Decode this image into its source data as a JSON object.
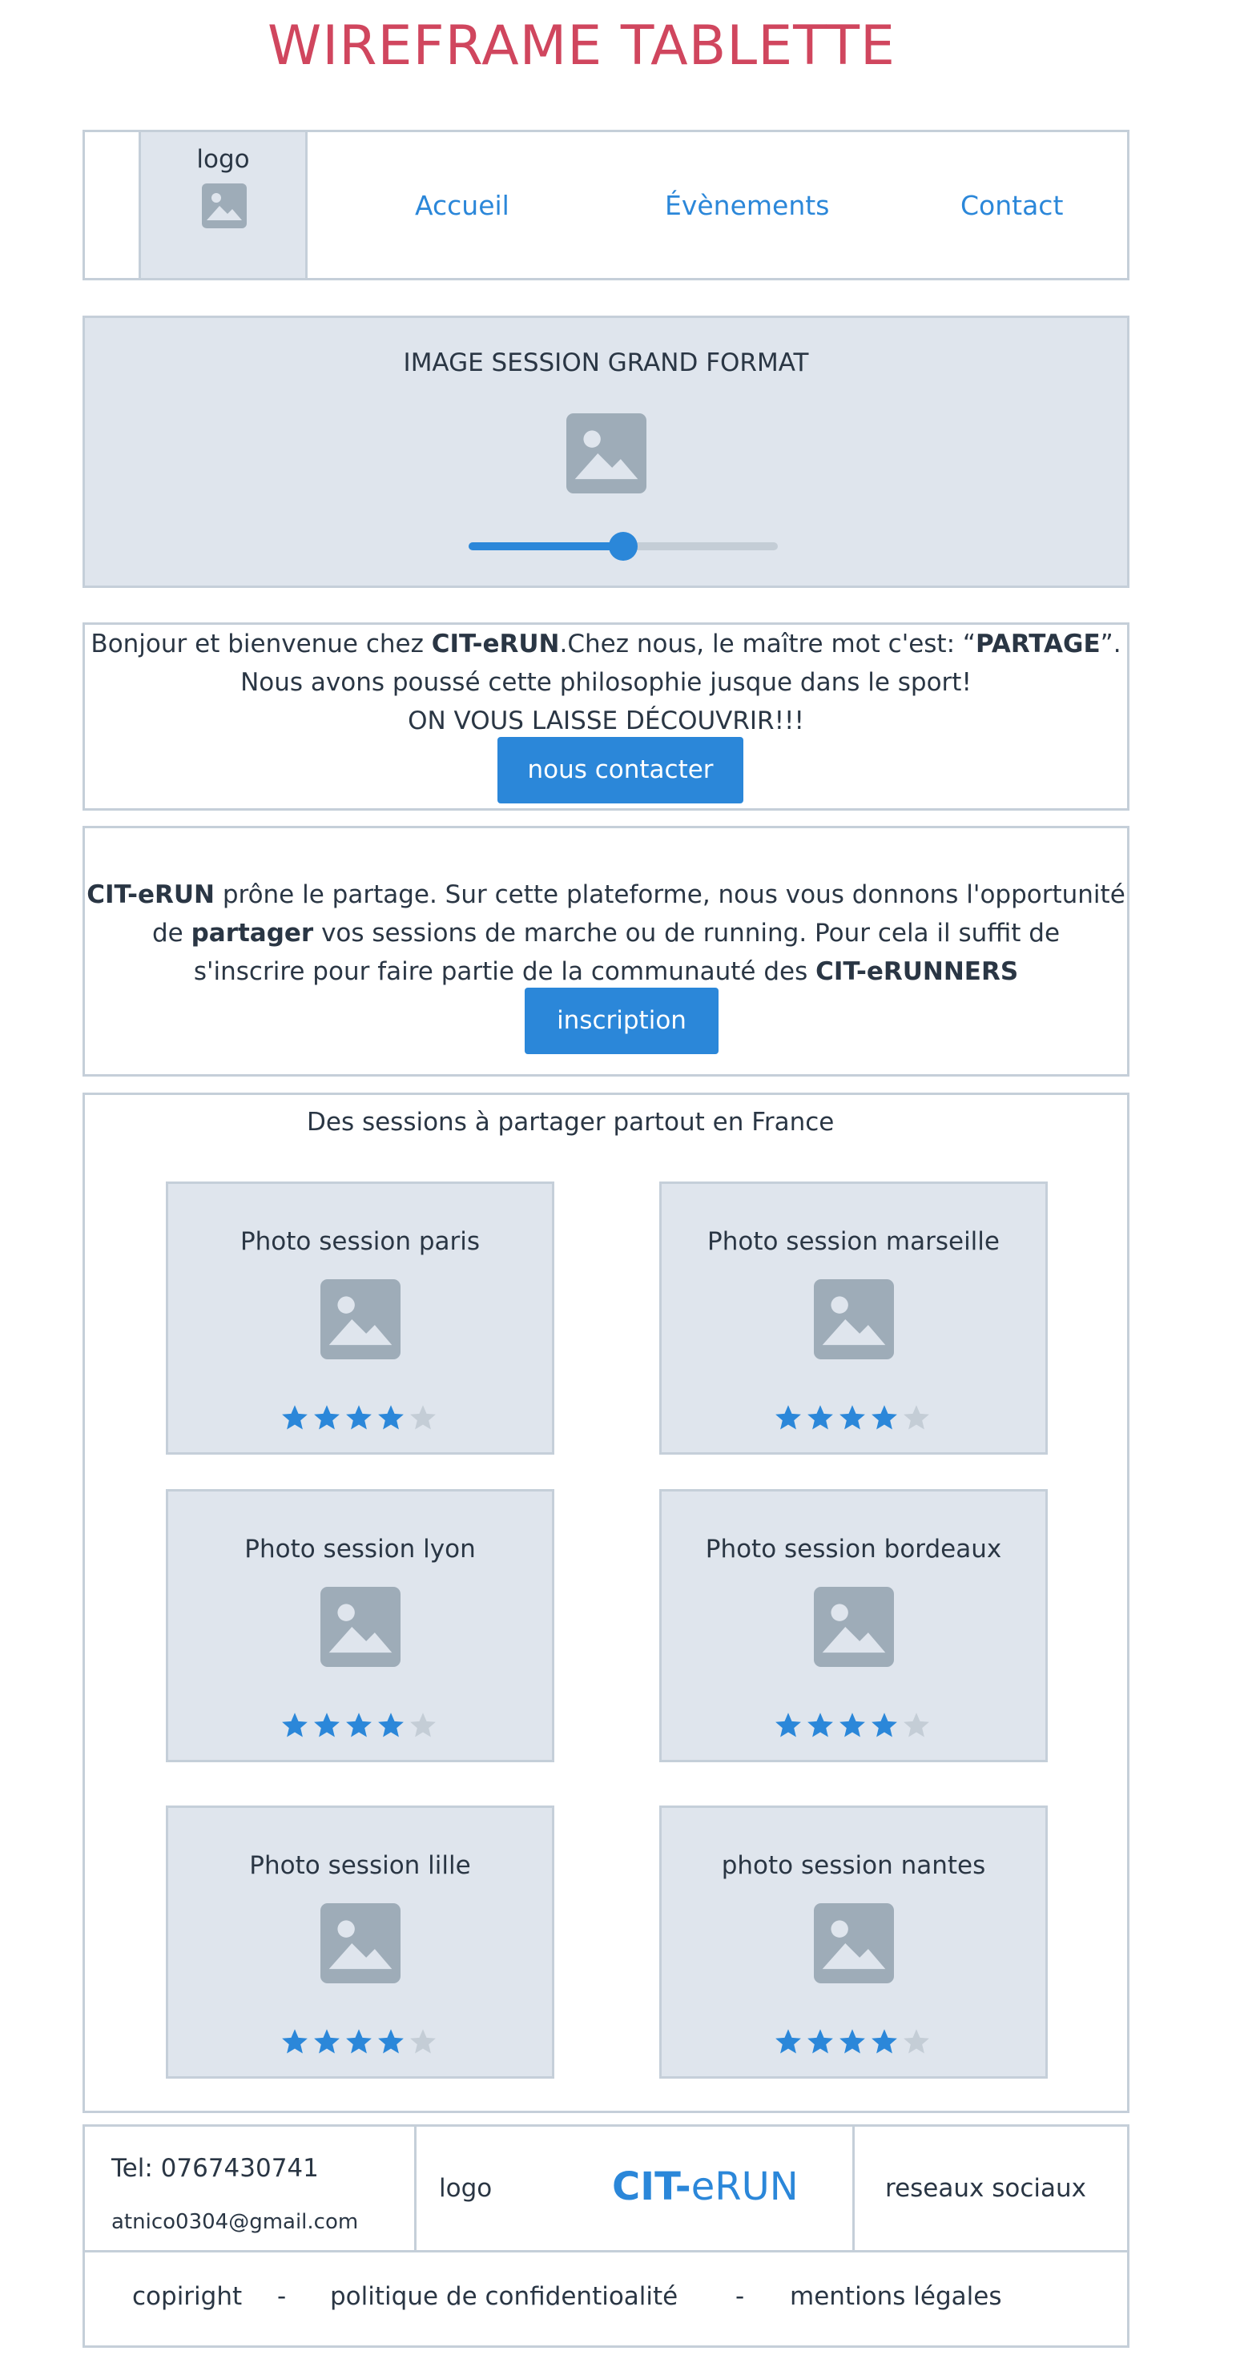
{
  "page": {
    "title": "WIREFRAME TABLETTE"
  },
  "colors": {
    "accent": "#2b87d9",
    "title": "#d0465e",
    "placeholder_bg": "#dfe5ed",
    "border": "#c5cfd9",
    "icon": "#9eacb8",
    "star_off": "#c4cdd6"
  },
  "header": {
    "logo_label": "logo",
    "logo_icon": "image-placeholder-icon",
    "nav": [
      {
        "label": "Accueil"
      },
      {
        "label": "Évènements"
      },
      {
        "label": "Contact"
      }
    ]
  },
  "hero": {
    "title": "IMAGE SESSION GRAND FORMAT",
    "icon": "image-placeholder-icon",
    "slider_value": 0.5
  },
  "welcome": {
    "line1_pre": "Bonjour et bienvenue chez ",
    "line1_brand": "CIT-eRUN",
    "line1_mid": ".Chez nous, le maître mot c'est: “",
    "line1_word": "PARTAGE",
    "line1_post": "”.",
    "line2": "Nous avons poussé cette philosophie jusque dans le sport!",
    "line3": "ON VOUS LAISSE DÉCOUVRIR!!!",
    "button": "nous contacter"
  },
  "about": {
    "l1_brand": "CIT-eRUN",
    "l1_rest": " prône le partage. Sur cette plateforme, nous vous donnons l'opportunité",
    "l2_pre": "de ",
    "l2_bold": "partager",
    "l2_rest": " vos sessions de marche ou de running. Pour cela il suffit de",
    "l3_pre": "s'inscrire pour faire partie de la communauté des ",
    "l3_bold": "CIT-eRUNNERS",
    "button": "inscription"
  },
  "sessions": {
    "heading": "Des sessions à partager partout en France",
    "cards": [
      {
        "title": "Photo session paris",
        "rating": 4,
        "max": 5
      },
      {
        "title": "Photo session marseille",
        "rating": 4,
        "max": 5
      },
      {
        "title": "Photo session lyon",
        "rating": 4,
        "max": 5
      },
      {
        "title": "Photo session bordeaux",
        "rating": 4,
        "max": 5
      },
      {
        "title": "Photo session lille",
        "rating": 4,
        "max": 5
      },
      {
        "title": "photo session nantes",
        "rating": 4,
        "max": 5
      }
    ]
  },
  "footer": {
    "tel": "Tel: 0767430741",
    "email": "atnico0304@gmail.com",
    "logo_label": "logo",
    "brand_a": "CIT-",
    "brand_b": "eRUN",
    "social": "reseaux sociaux",
    "links": [
      {
        "label": "copiright"
      },
      {
        "label": "-"
      },
      {
        "label": "politique de confidentioalité"
      },
      {
        "label": "-"
      },
      {
        "label": "mentions légales"
      }
    ]
  }
}
